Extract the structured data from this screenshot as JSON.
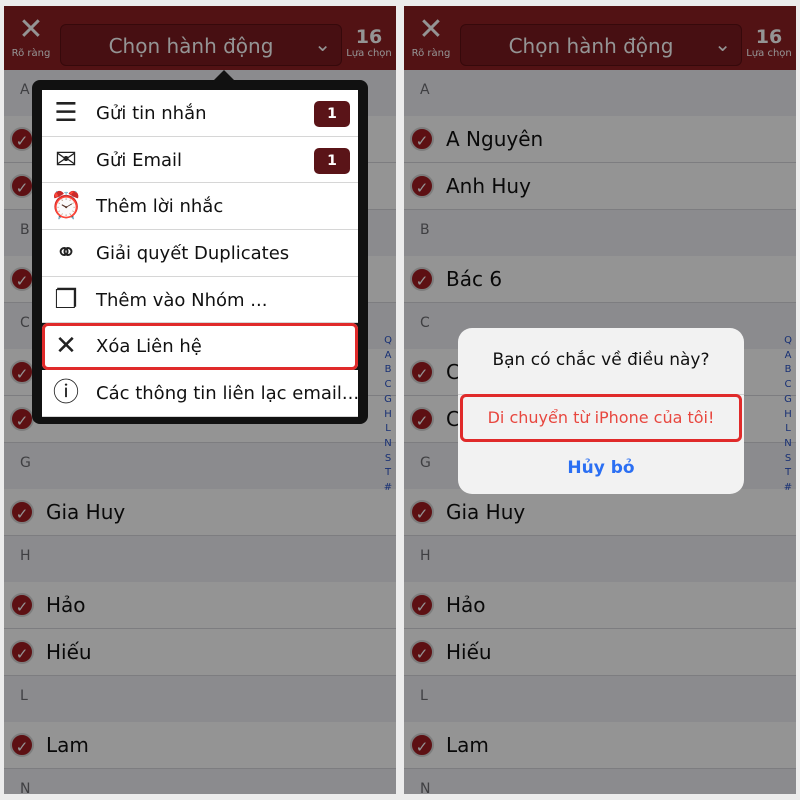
{
  "topbar": {
    "clear_label": "Rõ ràng",
    "action_title": "Chọn hành động",
    "count": "16",
    "count_label": "Lựa chọn"
  },
  "contacts_left": {
    "sections": [
      {
        "letter": "A",
        "names": [
          "",
          ""
        ]
      },
      {
        "letter": "B",
        "names": [
          ""
        ]
      },
      {
        "letter": "C",
        "names": [
          "",
          ""
        ]
      },
      {
        "letter": "G",
        "names": [
          "Gia Huy"
        ]
      },
      {
        "letter": "H",
        "names": [
          "Hảo",
          "Hiếu"
        ]
      },
      {
        "letter": "L",
        "names": [
          "Lam"
        ]
      },
      {
        "letter": "N",
        "names": []
      }
    ]
  },
  "contacts_right": {
    "sections": [
      {
        "letter": "A",
        "names": [
          "A Nguyên",
          "Anh Huy"
        ]
      },
      {
        "letter": "B",
        "names": [
          "Bác 6"
        ]
      },
      {
        "letter": "C",
        "names": [
          "C",
          "C"
        ]
      },
      {
        "letter": "G",
        "names": [
          "Gia Huy"
        ]
      },
      {
        "letter": "H",
        "names": [
          "Hảo",
          "Hiếu"
        ]
      },
      {
        "letter": "L",
        "names": [
          "Lam"
        ]
      },
      {
        "letter": "N",
        "names": []
      }
    ]
  },
  "index_letters": [
    "Q",
    "A",
    "B",
    "C",
    "G",
    "H",
    "L",
    "N",
    "S",
    "T",
    "#"
  ],
  "menu": {
    "items": [
      {
        "icon": "message-icon",
        "glyph": "☰",
        "label": "Gửi tin nhắn",
        "badge": "1"
      },
      {
        "icon": "envelope-icon",
        "glyph": "✉",
        "label": "Gửi Email",
        "badge": "1"
      },
      {
        "icon": "alarm-clock-icon",
        "glyph": "⏰",
        "label": "Thêm lời nhắc",
        "badge": ""
      },
      {
        "icon": "overlap-circles-icon",
        "glyph": "⚭",
        "label": "Giải quyết Duplicates",
        "badge": ""
      },
      {
        "icon": "documents-icon",
        "glyph": "❐",
        "label": "Thêm vào Nhóm ...",
        "badge": ""
      },
      {
        "icon": "delete-x-icon",
        "glyph": "✕",
        "label": "Xóa Liên hệ",
        "badge": "",
        "highlight": true
      },
      {
        "icon": "info-icon",
        "glyph": "ⓘ",
        "label": "Các thông tin liên lạc email...",
        "badge": ""
      }
    ]
  },
  "alert": {
    "question": "Bạn có chắc về điều này?",
    "remove_label": "Di chuyển từ iPhone của tôi!",
    "cancel_label": "Hủy bỏ"
  },
  "colors": {
    "brand": "#8e1f24",
    "highlight": "#e02a2a",
    "link": "#2b6ff3"
  }
}
